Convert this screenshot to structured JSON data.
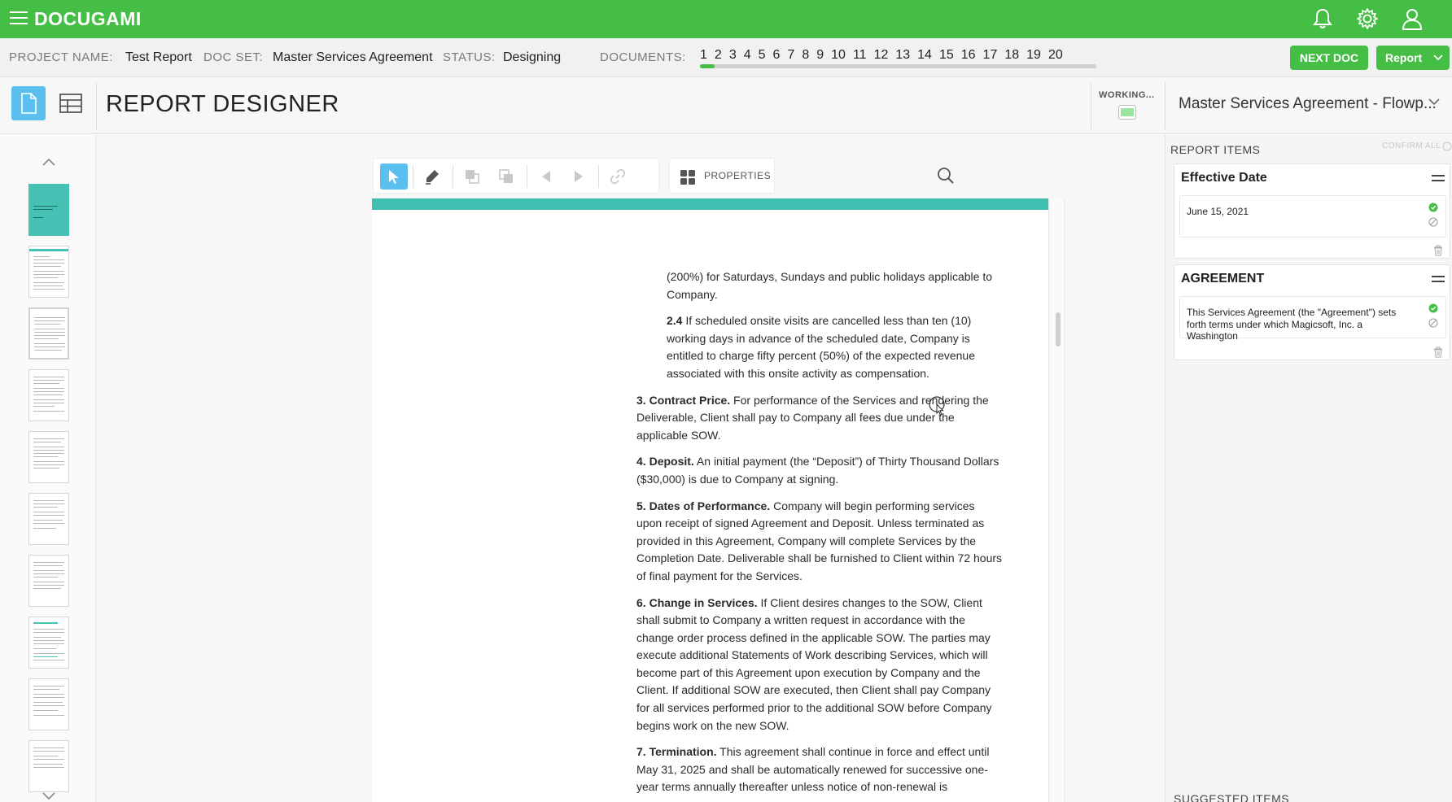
{
  "app": {
    "brand": "DOCUGAMI"
  },
  "project": {
    "project_name_label": "PROJECT NAME:",
    "project_name": "Test Report",
    "doc_set_label": "DOC SET:",
    "doc_set": "Master Services Agreement",
    "status_label": "STATUS:",
    "status": "Designing",
    "documents_label": "DOCUMENTS:",
    "documents": [
      "1",
      "2",
      "3",
      "4",
      "5",
      "6",
      "7",
      "8",
      "9",
      "10",
      "11",
      "12",
      "13",
      "14",
      "15",
      "16",
      "17",
      "18",
      "19",
      "20"
    ],
    "current_document": "1",
    "next_doc_label": "NEXT DOC",
    "report_label": "Report"
  },
  "designer": {
    "title": "REPORT DESIGNER",
    "working_label": "WORKING...",
    "document_selector": "Master Services Agreement - Flowp..."
  },
  "toolbar": {
    "properties_label": "PROPERTIES",
    "tools": [
      "select-tool",
      "highlight-tool",
      "group-tool",
      "ungroup-tool",
      "previous-tool",
      "next-tool",
      "link-tool"
    ]
  },
  "document": {
    "paragraphs": [
      {
        "num": "",
        "heading": "",
        "text": "(200%) for Saturdays, Sundays and public holidays applicable to Company.",
        "indent": true
      },
      {
        "num": "2.4",
        "heading": "",
        "text": " If scheduled onsite visits are cancelled less than ten (10) working days in advance of the scheduled date, Company is entitled to charge fifty percent (50%) of the expected revenue associated with this onsite activity as compensation.",
        "indent": true
      },
      {
        "num": "3.",
        "heading": "Contract Price.",
        "text": " For performance of the Services and rendering the Deliverable, Client shall pay to Company all fees due under the applicable SOW.",
        "indent": false
      },
      {
        "num": "4.",
        "heading": "Deposit.",
        "text": " An initial payment (the “Deposit”) of Thirty Thousand Dollars ($30,000) is due to Company at signing.",
        "indent": false
      },
      {
        "num": "5.",
        "heading": "Dates of Performance.",
        "text": " Company will begin performing services upon receipt of signed Agreement and Deposit. Unless terminated as provided in this Agreement, Company will complete Services by the Completion Date. Deliverable shall be furnished to Client within 72 hours of final payment for the Services.",
        "indent": false
      },
      {
        "num": "6.",
        "heading": "Change in Services.",
        "text": " If Client desires changes to the SOW, Client shall submit to Company a written request in accordance with the change order process defined in the applicable SOW. The parties may execute additional Statements of Work describing Services, which will become part of this Agreement upon execution by Company and the Client. If additional SOW are executed, then Client shall pay Company for all services performed prior to the additional SOW before Company begins work on the new SOW.",
        "indent": false
      },
      {
        "num": "7.",
        "heading": "Termination.",
        "text": " This agreement shall continue in force and effect until May 31, 2025 and shall be automatically renewed for successive one-year terms annually thereafter unless notice of non-renewal is",
        "indent": false
      }
    ]
  },
  "report_items": {
    "header": "REPORT ITEMS",
    "confirm_all": "CONFIRM ALL",
    "items": [
      {
        "title": "Effective Date",
        "value": "June 15, 2021"
      },
      {
        "title": "AGREEMENT",
        "value": "This Services Agreement (the \"Agreement\") sets forth terms under which Magicsoft, Inc. a Washington"
      }
    ],
    "suggested_header": "SUGGESTED ITEMS"
  },
  "colors": {
    "brand_green": "#45be45",
    "teal": "#3fbfb0",
    "active_blue": "#5bc0f0"
  }
}
